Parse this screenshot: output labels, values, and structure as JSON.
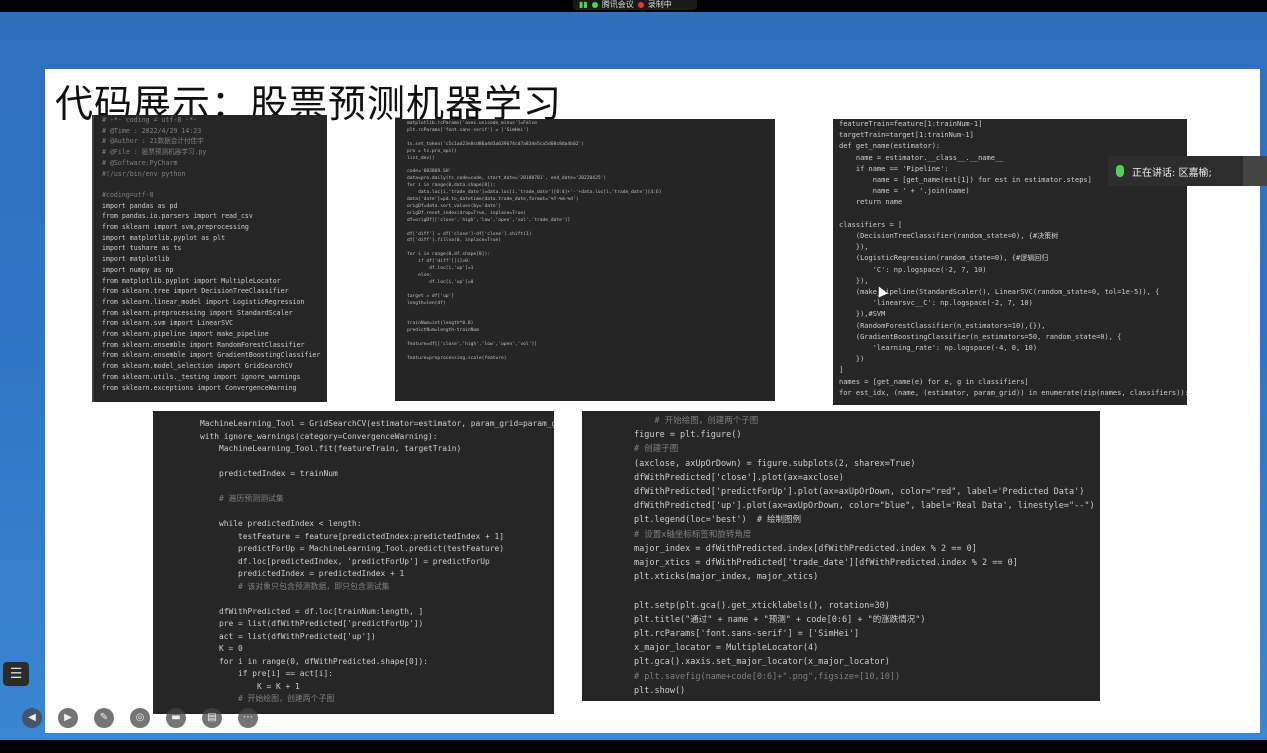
{
  "meeting": {
    "app_label": "腾讯会议",
    "recording_label": "录制中",
    "speaker_label": "正在讲话: 区嘉榆;"
  },
  "slide": {
    "title": "代码展示：股票预测机器学习"
  },
  "code_panels": {
    "imports": [
      "# -*- coding = utf-8 -*-",
      "# @Time : 2022/4/29 14:23",
      "# @Author : 21数据会计付佳宇",
      "# @File : 股票预测机器学习.py",
      "# @Software:PyCharm",
      "#!/usr/bin/env python",
      "",
      "#coding=utf-8",
      "import pandas as pd",
      "from pandas.io.parsers import read_csv",
      "from sklearn import svm,preprocessing",
      "import matplotlib.pyplot as plt",
      "import tushare as ts",
      "import matplotlib",
      "import numpy as np",
      "from matplotlib.pyplot import MultipleLocator",
      "from sklearn.tree import DecisionTreeClassifier",
      "from sklearn.linear_model import LogisticRegression",
      "from sklearn.preprocessing import StandardScaler",
      "from sklearn.svm import LinearSVC",
      "from sklearn.pipeline import make_pipeline",
      "from sklearn.ensemble import RandomForestClassifier",
      "from sklearn.ensemble import GradientBoostingClassifier",
      "from sklearn.model_selection import GridSearchCV",
      "from sklearn.utils._testing import ignore_warnings",
      "from sklearn.exceptions import ConvergenceWarning"
    ],
    "data_prep": [
      "matplotlib.rcParams['axes.unicode_minus']=False",
      "plt.rcParams['font.sans-serif'] = ['SimHei']",
      "",
      "ts.set_token('c5c1ad23e0cd86a4d3a639674cd7a834e5ca5d08c8da4b02')",
      "pro = ts.pro_api()",
      "list_dev()",
      "",
      "code='603869.SH'",
      "data=pro.daily(ts_code=code, start_date='20180701', end_date='20220425')",
      "for i in range(0,data.shape[0]):",
      "    data.loc[i,'trade_date']=data.loc[i,'trade_date'][0:4]+'-'+data.loc[i,'trade_date'][4:6]",
      "data['date']=pd.to_datetime(data.trade_date,format='%Y-%m-%d')",
      "origDf=data.sort_values(by='date')",
      "origDf.reset_index(drop=True, inplace=True)",
      "df=origDf[['close','high','low','open','vol','trade_date']]",
      "",
      "df['diff'] = df['close']-df['close'].shift(1)",
      "df['diff'].fillna(0, inplace=True)",
      "",
      "for i in range(0,df.shape[0]):",
      "    if df['diff'][i]>0:",
      "        df.loc[i,'up']=1",
      "    else:",
      "        df.loc[i,'up']=0",
      "",
      "target = df['up']",
      "length=len(df)",
      "",
      "",
      "trainNum=int(length*0.8)",
      "predictNum=length-trainNum",
      "",
      "feature=df[['close','high','low','open','vol']]",
      "",
      "feature=preprocessing.scale(feature)",
      ""
    ],
    "classifiers": [
      "featureTrain=feature[1:trainNum-1]",
      "targetTrain=target[1:trainNum-1]",
      "def get_name(estimator):",
      "    name = estimator.__class__.__name__",
      "    if name == 'Pipeline':",
      "        name = [get_name(est[1]) for est in estimator.steps]",
      "        name = ' + '.join(name)",
      "    return name",
      "",
      "classifiers = [",
      "    (DecisionTreeClassifier(random_state=0), {#决策树",
      "    }),",
      "    (LogisticRegression(random_state=0), {#逻辑回归",
      "        'C': np.logspace(-2, 7, 10)",
      "    }),",
      "    (make_pipeline(StandardScaler(), LinearSVC(random_state=0, tol=1e-5)), {",
      "        'linearsvc__C': np.logspace(-2, 7, 10)",
      "    }),#SVM",
      "    (RandomForestClassifier(n_estimators=10),{}),",
      "    (GradientBoostingClassifier(n_estimators=50, random_state=0), {",
      "        'learning_rate': np.logspace(-4, 0, 10)",
      "    })",
      "]",
      "names = [get_name(e) for e, g in classifiers]",
      "for est_idx, (name, (estimator, param_grid)) in enumerate(zip(names, classifiers)):"
    ],
    "training": [
      "    MachineLearning_Tool = GridSearchCV(estimator=estimator, param_grid=param_grid)",
      "    with ignore_warnings(category=ConvergenceWarning):",
      "        MachineLearning_Tool.fit(featureTrain, targetTrain)",
      "",
      "        predictedIndex = trainNum",
      "",
      "        # 遍历预测测试集",
      "",
      "        while predictedIndex < length:",
      "            testFeature = feature[predictedIndex:predictedIndex + 1]",
      "            predictForUp = MachineLearning_Tool.predict(testFeature)",
      "            df.loc[predictedIndex, 'predictForUp'] = predictForUp",
      "            predictedIndex = predictedIndex + 1",
      "            # 该对象只包含预测数据，即只包含测试集",
      "",
      "        dfWithPredicted = df.loc[trainNum:length, ]",
      "        pre = list(dfWithPredicted['predictForUp'])",
      "        act = list(dfWithPredicted['up'])",
      "        K = 0",
      "        for i in range(0, dfWithPredicted.shape[0]):",
      "            if pre[i] == act[i]:",
      "                K = K + 1",
      "            # 开始绘图，创建两个子图"
    ],
    "plotting": [
      "    # 开始绘图，创建两个子图",
      "figure = plt.figure()",
      "# 创建子图",
      "(axclose, axUpOrDown) = figure.subplots(2, sharex=True)",
      "dfWithPredicted['close'].plot(ax=axclose)",
      "dfWithPredicted['predictForUp'].plot(ax=axUpOrDown, color=\"red\", label='Predicted Data')",
      "dfWithPredicted['up'].plot(ax=axUpOrDown, color=\"blue\", label='Real Data', linestyle=\"--\")",
      "plt.legend(loc='best')  # 绘制图例",
      "# 设置x轴坐标标签和旋转角度",
      "major_index = dfWithPredicted.index[dfWithPredicted.index % 2 == 0]",
      "major_xtics = dfWithPredicted['trade_date'][dfWithPredicted.index % 2 == 0]",
      "plt.xticks(major_index, major_xtics)",
      "",
      "plt.setp(plt.gca().get_xticklabels(), rotation=30)",
      "plt.title(\"通过\" + name + \"预测\" + code[0:6] + \"的涨跌情况\")",
      "plt.rcParams['font.sans-serif'] = ['SimHei']",
      "x_major_locator = MultipleLocator(4)",
      "plt.gca().xaxis.set_major_locator(x_major_locator)",
      "# plt.savefig(name+code[0:6]+\".png\",figsize=[10,10])",
      "plt.show()"
    ]
  },
  "colors": {
    "code_bg": "#262626",
    "keyword": "#cc7832",
    "comment": "#808080",
    "string": "#6a8759",
    "number": "#6897bb",
    "slide_bg": "#ffffff",
    "frame_blue": "#2f74c4"
  },
  "icons": {
    "side_menu": "list-icon",
    "toolbar": [
      "prev-icon",
      "next-icon",
      "pen-icon",
      "camera-icon",
      "video-icon",
      "chat-icon",
      "more-icon"
    ]
  }
}
